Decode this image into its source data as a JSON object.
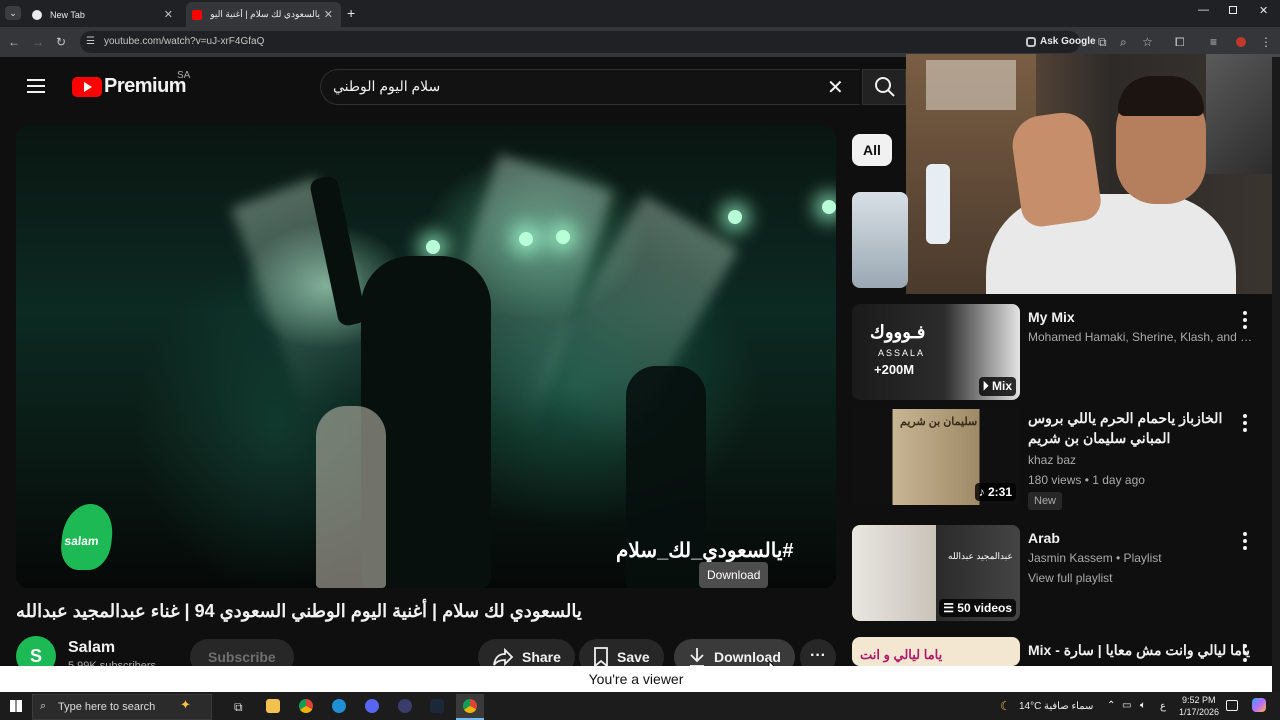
{
  "browser": {
    "tabs": [
      {
        "label": "New Tab"
      },
      {
        "label": "يالسعودي لك سلام | أغنية اليوم ال"
      }
    ],
    "url": "youtube.com/watch?v=uJ-xrF4GfaQ",
    "ask_google": "Ask Google"
  },
  "header": {
    "logo_text": "Premium",
    "region": "SA",
    "search_value": "سلام اليوم الوطني"
  },
  "player": {
    "hashtag": "#يالسعودي_لك_سلام",
    "channel_watermark": "salam",
    "tooltip": "Download"
  },
  "video": {
    "title": "يالسعودي لك سلام | أغنية اليوم الوطني السعودي 94 | غناء عبدالمجيد عبدالله",
    "channel_name": "Salam",
    "channel_initial": "S",
    "subscribers": "5.99K subscribers",
    "subscribe_label": "Subscribe",
    "share_label": "Share",
    "save_label": "Save",
    "download_label": "Download"
  },
  "sidebar": {
    "chips": [
      {
        "label": "All"
      }
    ],
    "items": [
      {
        "title": "My Mix",
        "meta1": "Mohamed Hamaki, Sherine, Klash, and m...",
        "overlay": "Mix",
        "thumb_text": "فـوووك",
        "thumb_sub": "ASSALA",
        "thumb_views": "+200M"
      },
      {
        "title": "الخازباز  ياحمام الحرم ياللي بروس المباني سليمان بن شريم",
        "meta1": "khaz baz",
        "meta2": "180 views • 1 day ago",
        "badge": "New",
        "duration": "2:31",
        "thumb_text": "سليمان بن شريم"
      },
      {
        "title": "Arab",
        "meta1": "Jasmin Kassem • Playlist",
        "meta2": "View full playlist",
        "overlay": "50 videos",
        "thumb_text": "عبدالمجيد عبدالله"
      },
      {
        "title": "Mix - ياما ليالي وانت مش معايا | سارة هيثم",
        "thumb_text": "ياما ليالي و انت"
      }
    ]
  },
  "viewer_bar": "You're a viewer",
  "taskbar": {
    "search_placeholder": "Type here to search",
    "temperature": "14°C",
    "weather": "سماء صافية",
    "lang": "ع",
    "time": "9:52 PM",
    "date": "1/17/2026"
  },
  "colors": {
    "yt_red": "#ff0000",
    "bg": "#0f0f0f",
    "chip_active": "#f1f1f1",
    "salam_green": "#1db954"
  }
}
